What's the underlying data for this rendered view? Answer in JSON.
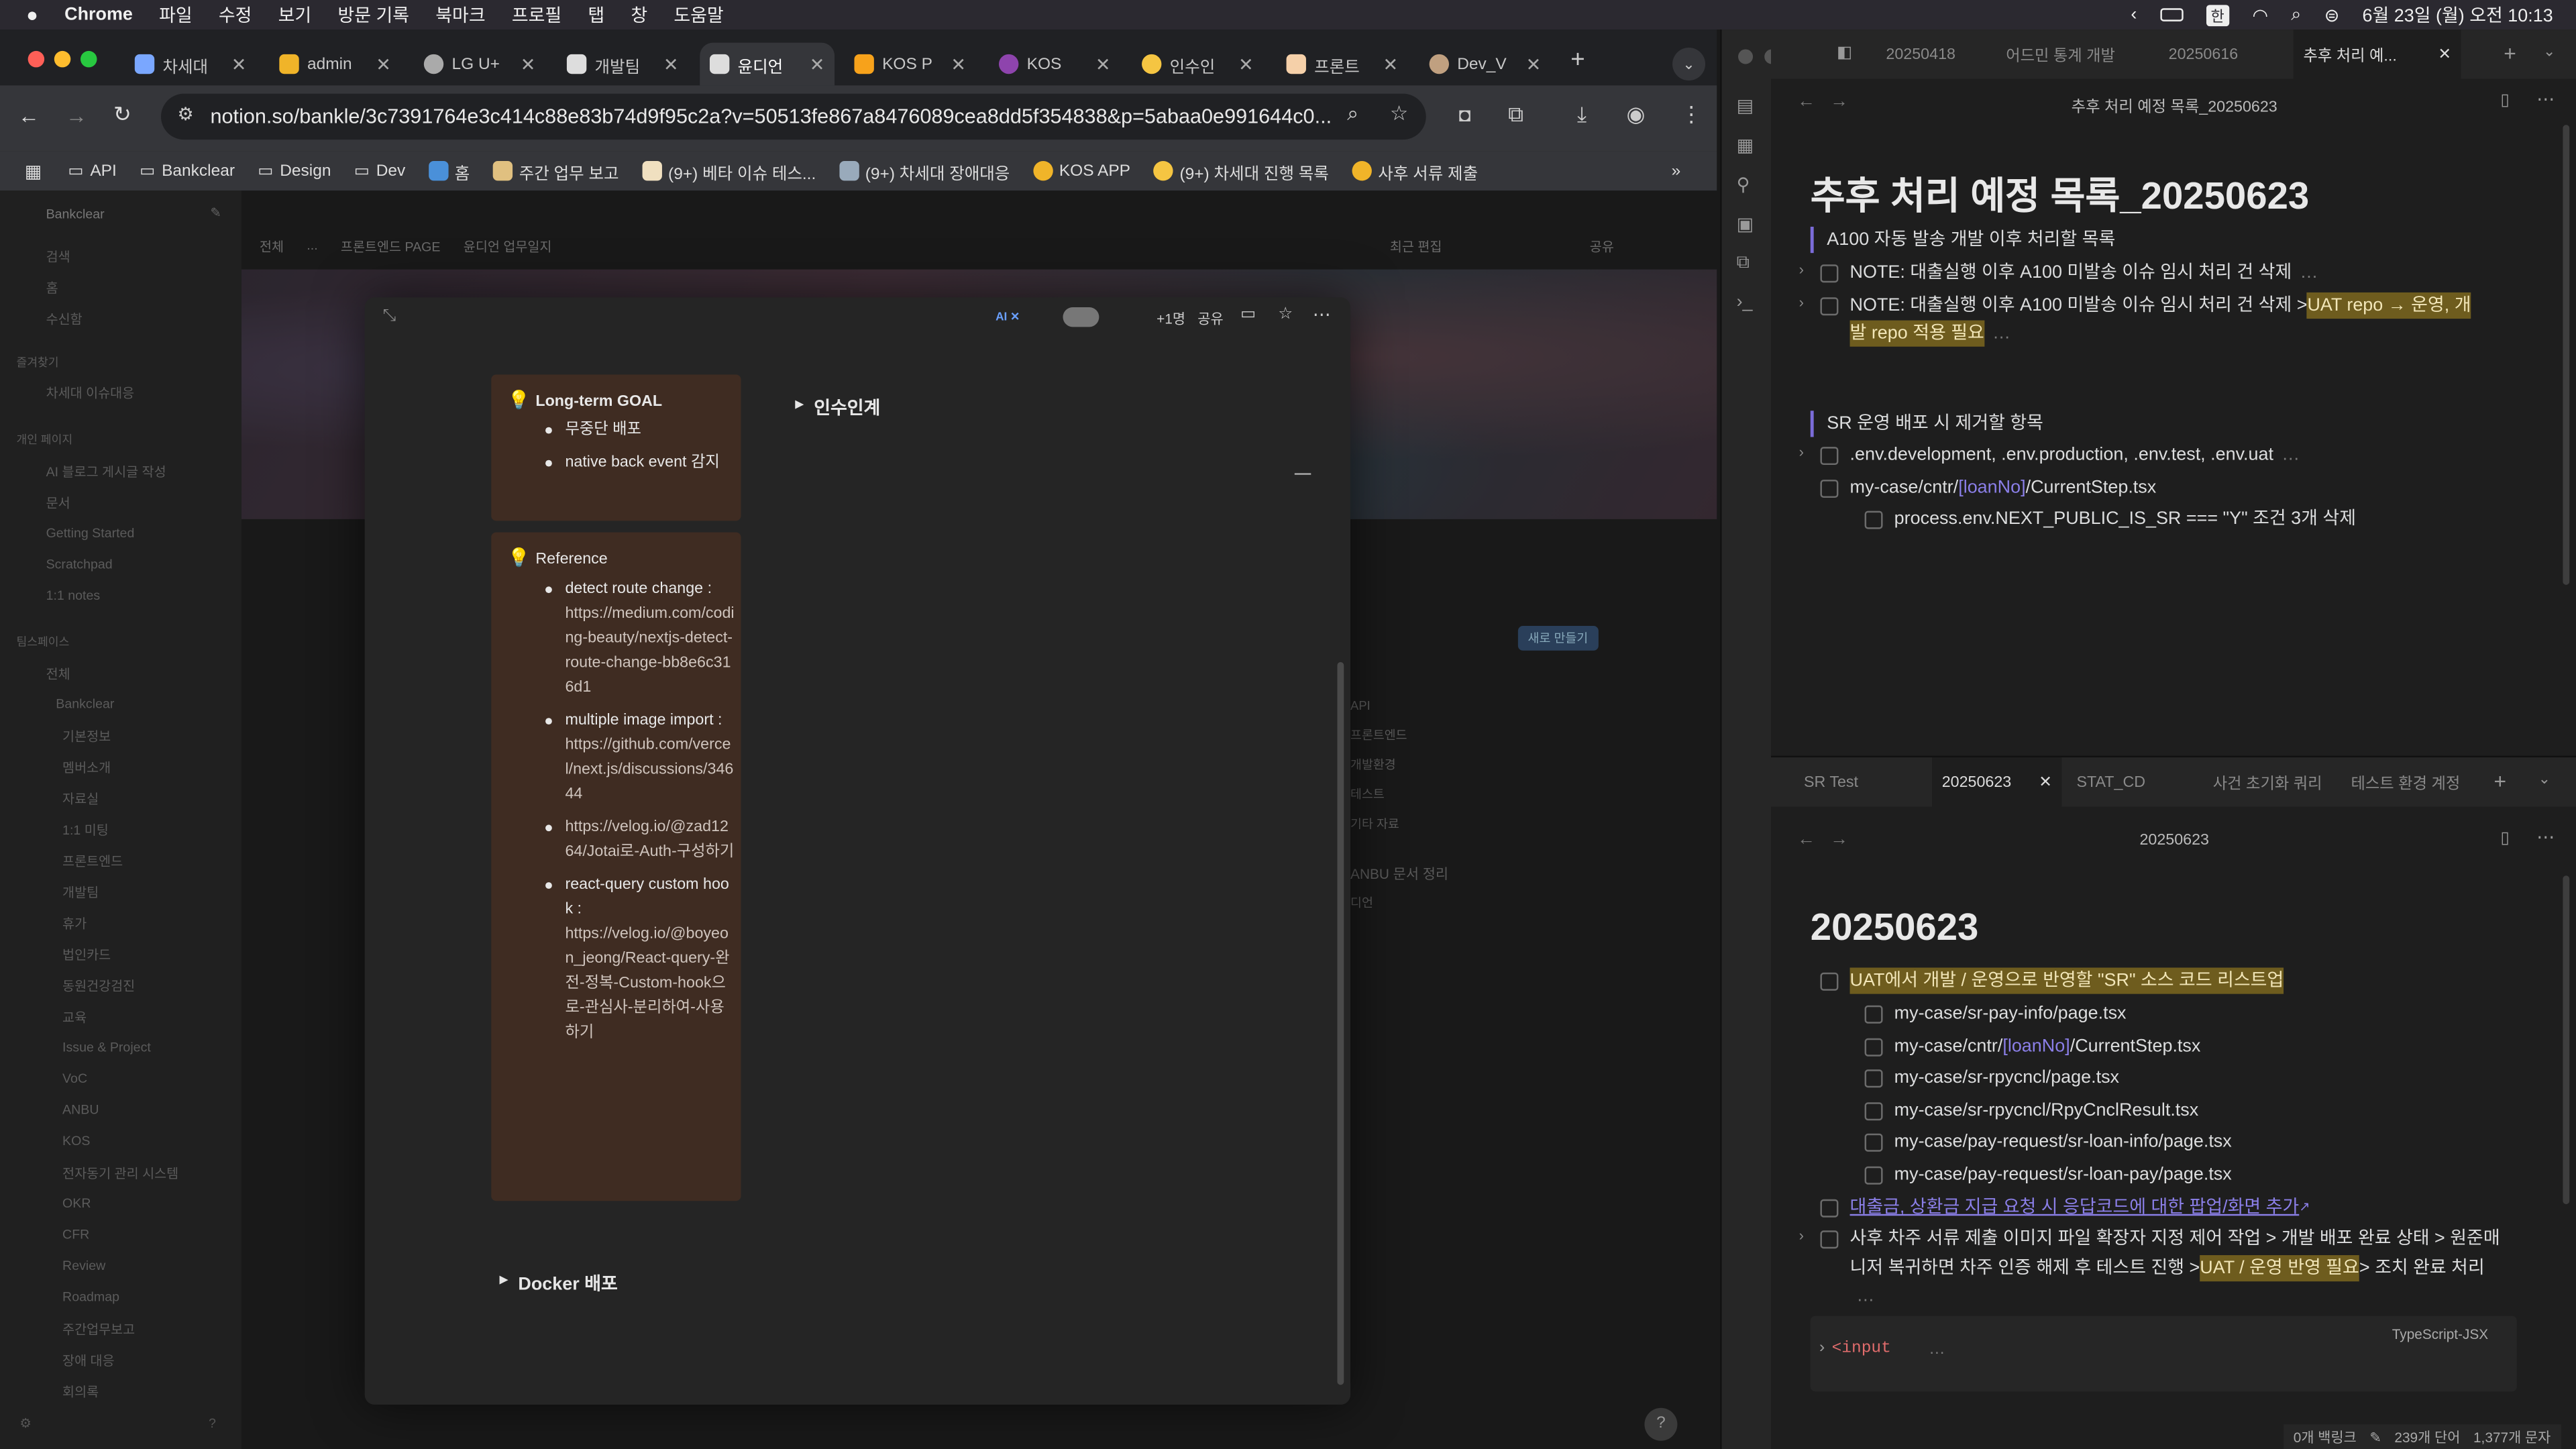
{
  "menubar": {
    "app": "Chrome",
    "items": [
      "파일",
      "수정",
      "보기",
      "방문 기록",
      "북마크",
      "프로필",
      "탭",
      "창",
      "도움말"
    ],
    "clock": "6월 23일 (월) 오전 10:13",
    "ime": "한"
  },
  "tabs": [
    {
      "label": "차세대",
      "color": "#7aa7ff"
    },
    {
      "label": "admin",
      "color": "#f0b429"
    },
    {
      "label": "LG U+",
      "color": "#aaaaaa"
    },
    {
      "label": "개발팀",
      "color": "#dddddd"
    },
    {
      "label": "윤디언",
      "color": "#dddddd"
    },
    {
      "label": "KOS P",
      "color": "#f7a21b"
    },
    {
      "label": "KOS",
      "color": "#8e44ad"
    },
    {
      "label": "인수인",
      "color": "#f5c542"
    },
    {
      "label": "프론트",
      "color": "#f5d0a9"
    },
    {
      "label": "Dev_V",
      "color": "#c0a080"
    }
  ],
  "omnibox": {
    "url": "notion.so/bankle/3c7391764e3c414c88e83b74d9f95c2a?v=50513fe867a8476089cea8dd5f354838&p=5abaa0e991644c0..."
  },
  "bookmarks": [
    "API",
    "Bankclear",
    "Design",
    "Dev",
    "홈",
    "주간 업무 보고",
    "(9+) 베타 이슈 테스...",
    "(9+) 차세대 장애대응",
    "KOS APP",
    "(9+) 차세대 진행 목록",
    "사후 서류 제출"
  ],
  "notion": {
    "workspace": "Bankclear",
    "breadcrumb": [
      "전체",
      "...",
      "프론트엔드 PAGE",
      "윤디언 업무일지"
    ],
    "topbar_right": [
      "최근 편집",
      "공유"
    ],
    "sidebar": [
      "검색",
      "홈",
      "수신함",
      "즐겨찾기",
      "차세대 이슈대응",
      "개인 페이지",
      "AI 블로그 게시글 작성",
      "문서",
      "Getting Started",
      "Scratchpad",
      "1:1 notes",
      "팀스페이스",
      "전체",
      "Bankclear",
      "기본정보",
      "멤버소개",
      "자료실",
      "1:1 미팅",
      "프론트엔드",
      "개발팀",
      "휴가",
      "법인카드",
      "동원건강검진",
      "교육",
      "Issue & Project",
      "VoC",
      "ANBU",
      "KOS",
      "전자동기 관리 시스템",
      "OKR",
      "CFR",
      "Review",
      "Roadmap",
      "주간업무보고",
      "장애 대응",
      "회의록"
    ],
    "db_partial": [
      "API",
      "프론트엔드",
      "개발환경",
      "테스트",
      "기타 자료",
      "ANBU 문서 정리",
      "디언"
    ],
    "new_button": "새로 만들기",
    "modal": {
      "share": "공유",
      "plus": "+1명",
      "goal": {
        "title": "Long-term GOAL",
        "items": [
          "무중단 배포",
          "native back event 감지"
        ]
      },
      "reference": {
        "title": "Reference",
        "items": [
          {
            "label": "detect route change :",
            "link": "https://medium.com/coding-beauty/nextjs-detect-route-change-bb8e6c316d1"
          },
          {
            "label": "multiple image import :",
            "link": "https://github.com/vercel/next.js/discussions/34644"
          },
          {
            "label": "",
            "link": "https://velog.io/@zad1264/Jotai로-Auth-구성하기"
          },
          {
            "label": "react-query custom hook :",
            "link": "https://velog.io/@boyeon_jeong/React-query-완전-정복-Custom-hook으로-관심사-분리하여-사용하기"
          }
        ]
      },
      "toggle1": "인수인계",
      "toggle2": "Docker 배포"
    }
  },
  "obsidian": {
    "top_tabs": [
      "20250418",
      "어드민 통계 개발",
      "20250616",
      "추후 처리 예..."
    ],
    "top_title": "추후 처리 예정 목록_20250623",
    "top_heading": "추후 처리 예정 목록_20250623",
    "top_lines": [
      "A100 자동 발송 개발 이후 처리할 목록",
      "NOTE: 대출실행 이후 A100 미발송 이슈 임시 처리 건 삭제",
      "NOTE: 대출실행 이후 A100 미발송 이슈 임시 처리 건 삭제 > ",
      "UAT repo → 운영, 개",
      "발 repo 적용 필요",
      "SR 운영 배포 시 제거할 항목",
      ".env.development, .env.production, .env.test, .env.uat",
      "my-case/cntr/",
      "[loanNo]",
      "/CurrentStep.tsx",
      "process.env.NEXT_PUBLIC_IS_SR === \"Y\" 조건 3개 삭제"
    ],
    "bottom_tabs": [
      "SR Test",
      "20250623",
      "STAT_CD",
      "사건 초기화 쿼리",
      "테스트 환경 계정"
    ],
    "bottom_title": "20250623",
    "bottom_heading": "20250623",
    "bottom_lines": [
      "UAT에서 개발 / 운영으로 반영할 \"SR\" 소스 코드 리스트업",
      "my-case/sr-pay-info/page.tsx",
      "my-case/cntr/",
      "[loanNo]",
      "/CurrentStep.tsx",
      "my-case/sr-rpycncl/page.tsx",
      "my-case/sr-rpycncl/RpyCnclResult.tsx",
      "my-case/pay-request/sr-loan-info/page.tsx",
      "my-case/pay-request/sr-loan-pay/page.tsx",
      "대출금, 상환금 지급 요청 시 응답코드에 대한 팝업/화면 추가",
      "사후 차주 서류 제출 이미지 파일 확장자 지정 제어 작업 > 개발 배포 완료 상태 > 원준매",
      "니저 복귀하면 차주 인증 해제 후 테스트 진행 > ",
      "UAT / 운영 반영 필요",
      " > 조치 완료 처리",
      "<input",
      "TypeScript-JSX"
    ],
    "status": [
      "0개 백링크",
      "239개 단어",
      "1,377개 문자"
    ]
  }
}
